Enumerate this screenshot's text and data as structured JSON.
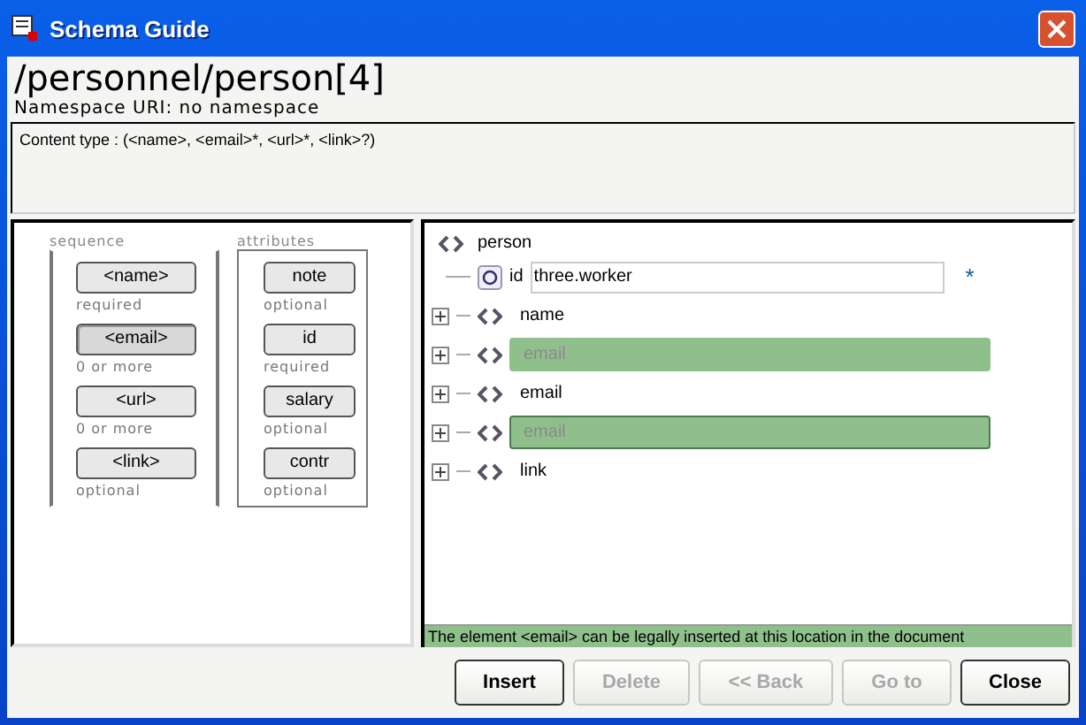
{
  "window": {
    "title": "Schema Guide"
  },
  "path": "/personnel/person[4]",
  "namespace": "Namespace URI: no namespace",
  "content_type": "Content type : (<name>, <email>*, <url>*, <link>?)",
  "sequence": {
    "label": "sequence",
    "items": [
      {
        "label": "<name>",
        "occurrence": "required",
        "selected": false
      },
      {
        "label": "<email>",
        "occurrence": "0 or more",
        "selected": true
      },
      {
        "label": "<url>",
        "occurrence": "0 or more",
        "selected": false
      },
      {
        "label": "<link>",
        "occurrence": "optional",
        "selected": false
      }
    ]
  },
  "attributes": {
    "label": "attributes",
    "items": [
      {
        "label": "note",
        "occurrence": "optional",
        "selected": false
      },
      {
        "label": "id",
        "occurrence": "required",
        "selected": false
      },
      {
        "label": "salary",
        "occurrence": "optional",
        "selected": false
      },
      {
        "label": "contr",
        "occurrence": "optional",
        "selected": false
      }
    ]
  },
  "tree": {
    "name": "person",
    "children": [
      {
        "kind": "attribute",
        "name": "id",
        "value": "three.worker",
        "marker": "*"
      },
      {
        "kind": "element",
        "name": "name",
        "expanded": false
      },
      {
        "kind": "placeholder",
        "name": "email",
        "expanded": false,
        "selected": false
      },
      {
        "kind": "element",
        "name": "email",
        "expanded": false
      },
      {
        "kind": "placeholder",
        "name": "email",
        "expanded": false,
        "selected": true
      },
      {
        "kind": "element",
        "name": "link",
        "expanded": false
      }
    ]
  },
  "status": "The element <email> can be legally inserted at this location in the document",
  "buttons": [
    {
      "label": "Insert",
      "disabled": false
    },
    {
      "label": "Delete",
      "disabled": true
    },
    {
      "label": "<< Back",
      "disabled": true
    },
    {
      "label": "Go to",
      "disabled": true
    },
    {
      "label": "Close",
      "disabled": false
    }
  ]
}
